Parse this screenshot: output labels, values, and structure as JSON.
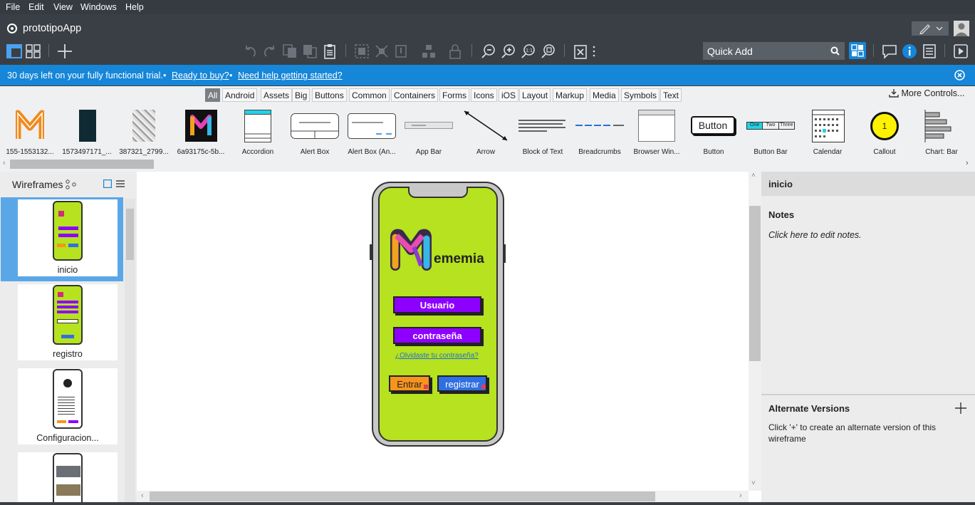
{
  "menu": [
    "File",
    "Edit",
    "View",
    "Windows",
    "Help"
  ],
  "app_title": "prototipoApp",
  "quick_add_placeholder": "Quick Add",
  "trial": {
    "days_text": "30 days left on your fully functional trial.",
    "bullet": "•",
    "buy_link": "Ready to buy?",
    "help_link": "Need help getting started?"
  },
  "library": {
    "categories": [
      "All",
      "Android",
      "Assets",
      "Big",
      "Buttons",
      "Common",
      "Containers",
      "Forms",
      "Icons",
      "iOS",
      "Layout",
      "Markup",
      "Media",
      "Symbols",
      "Text"
    ],
    "selected_category": "All",
    "more_controls": "More Controls...",
    "items": [
      "155-1553132...",
      "1573497171_...",
      "387321_2799...",
      "6a93175c-5b...",
      "Accordion",
      "Alert Box",
      "Alert Box (An...",
      "App Bar",
      "Arrow",
      "Block of Text",
      "Breadcrumbs",
      "Browser Win...",
      "Button",
      "Button Bar",
      "Calendar",
      "Callout",
      "Chart: Bar"
    ],
    "button_thumb": "Button",
    "buttonbar_thumb": [
      "One",
      "Two",
      "Three"
    ],
    "callout_thumb": "1"
  },
  "wireframes": {
    "title": "Wireframes",
    "pages": [
      "inicio",
      "registro",
      "Configuracion..."
    ],
    "selected": "inicio"
  },
  "mockup": {
    "logo_text": "ememia",
    "user_field": "Usuario",
    "password_field": "contraseña",
    "forgot_link": "¿Olvidaste tu contraseña?",
    "enter_button": "Entrar",
    "register_button": "registrar"
  },
  "inspector": {
    "page_name": "inicio",
    "notes_title": "Notes",
    "notes_placeholder": "Click here to edit notes.",
    "alt_title": "Alternate Versions",
    "alt_desc": "Click '+' to create an alternate version of this wireframe"
  },
  "colors": {
    "trial_bar": "#1586d8",
    "phone_screen": "#b6e21f",
    "input_purple": "#8d00ff",
    "enter_orange": "#f7941d",
    "register_blue": "#2f6fe0",
    "selected_thumb": "#5aa7e8"
  }
}
